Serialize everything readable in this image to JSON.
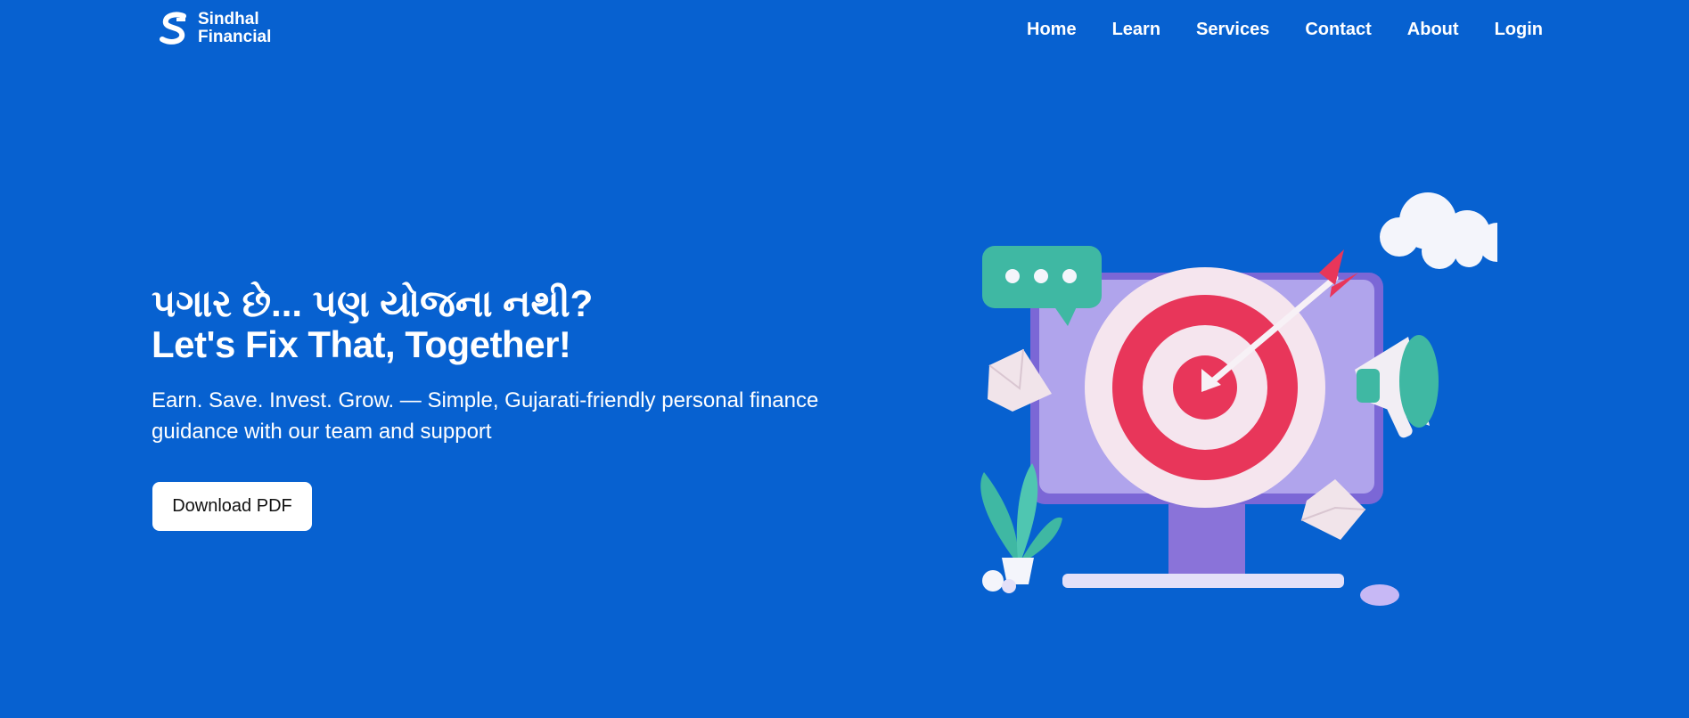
{
  "brand": {
    "line1": "Sindhal",
    "line2": "Financial"
  },
  "nav": {
    "items": [
      "Home",
      "Learn",
      "Services",
      "Contact",
      "About",
      "Login"
    ]
  },
  "hero": {
    "title_gujarati": "પગાર છે... પણ યોજના નથી?",
    "title_english": "Let's Fix That, Together!",
    "subtitle": "Earn. Save. Invest. Grow. — Simple, Gujarati-friendly personal finance guidance with our team and support",
    "cta_label": "Download PDF"
  },
  "illustration": {
    "icons": [
      "chat-bubble-icon",
      "target-icon",
      "arrow-icon",
      "megaphone-icon",
      "envelope-icon",
      "cloud-icon",
      "plant-icon",
      "monitor-icon"
    ]
  },
  "colors": {
    "background": "#0761d0",
    "button": "#ffffff",
    "target_red": "#e8365a",
    "monitor": "#a89be8",
    "teal": "#3fb8a3"
  }
}
